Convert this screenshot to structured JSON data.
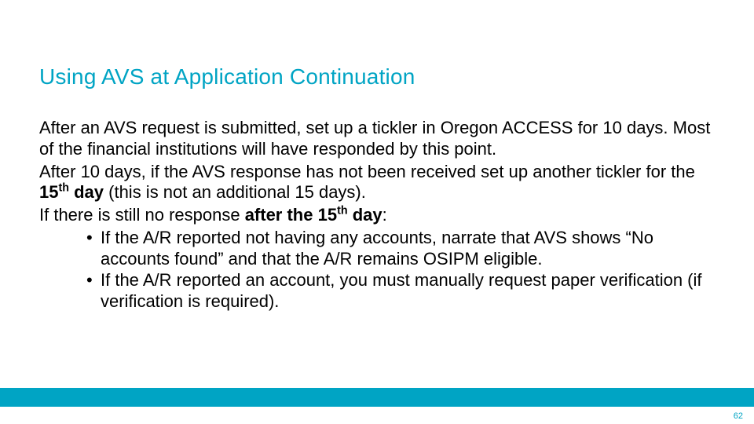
{
  "colors": {
    "accent": "#00A4C4",
    "text": "#000000",
    "background": "#FFFFFF"
  },
  "title": "Using AVS at Application Continuation",
  "body": {
    "p1": "After an AVS request is submitted, set up a tickler in Oregon ACCESS for 10 days. Most of the financial institutions will have responded by this point.",
    "p2_pre": "After 10 days, if the AVS response has not been received set up another tickler for the ",
    "p2_bold_day": "15",
    "p2_bold_suffix": " day",
    "p2_post": " (this is not an additional 15 days).",
    "p3_pre": "If there is still no response ",
    "p3_bold_pre": "after the 15",
    "p3_bold_post": " day",
    "p3_post": ":",
    "bullet1": "If the A/R reported not having any accounts, narrate that AVS shows “No accounts found” and that the A/R remains OSIPM eligible.",
    "bullet2": "If the A/R reported an account, you must manually request paper verification (if verification is required).",
    "ordinal": "th"
  },
  "page_number": "62"
}
